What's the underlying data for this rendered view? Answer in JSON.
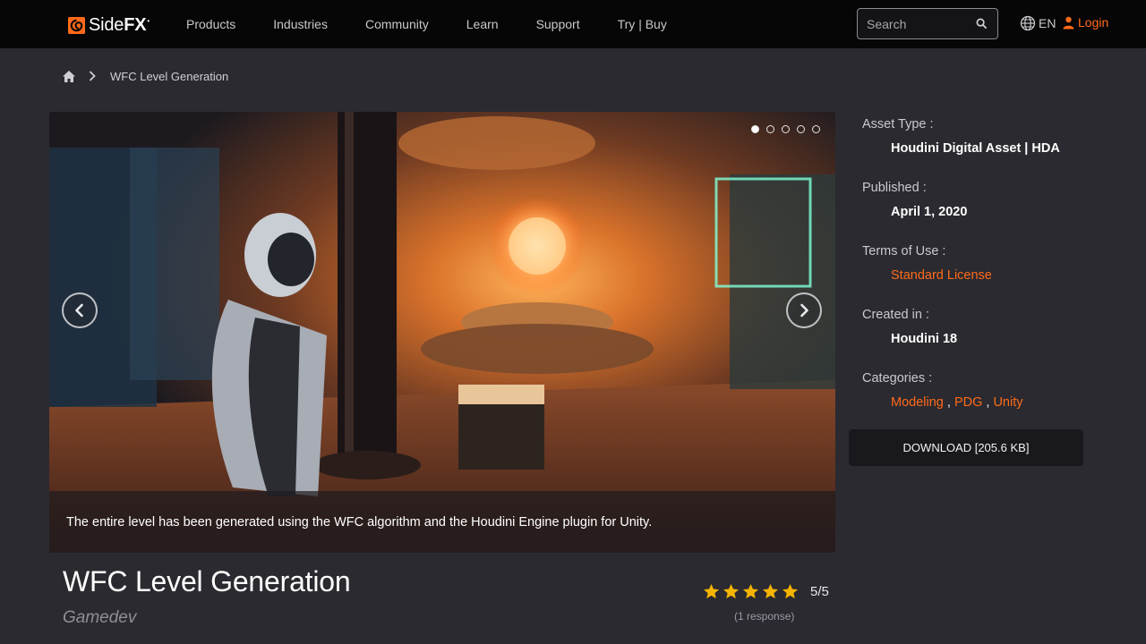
{
  "header": {
    "logo_prefix": "Side",
    "logo_suffix": "FX",
    "nav": [
      "Products",
      "Industries",
      "Community",
      "Learn",
      "Support",
      "Try | Buy"
    ],
    "search_placeholder": "Search",
    "language": "EN",
    "login_label": "Login",
    "accent": "#ff6b1a"
  },
  "breadcrumb": {
    "current": "WFC Level Generation"
  },
  "carousel": {
    "caption": "The entire level has been generated using the WFC algorithm and the Houdini Engine plugin for Unity.",
    "slide_count": 5,
    "active_slide": 1
  },
  "details": {
    "asset_type_label": "Asset Type :",
    "asset_type_value": "Houdini Digital Asset | HDA",
    "published_label": "Published :",
    "published_value": "April 1, 2020",
    "terms_label": "Terms of Use :",
    "terms_value": "Standard License",
    "created_label": "Created in :",
    "created_value": "Houdini 18",
    "categories_label": "Categories :",
    "categories": [
      "Modeling",
      "PDG",
      "Unity"
    ],
    "category_separator": ","
  },
  "download_label": "DOWNLOAD [205.6 KB]",
  "asset": {
    "title": "WFC Level Generation",
    "category": "Gamedev"
  },
  "rating": {
    "stars": 5,
    "score": "5/5",
    "responses": "(1 response)",
    "star_color": "#f5b400"
  }
}
